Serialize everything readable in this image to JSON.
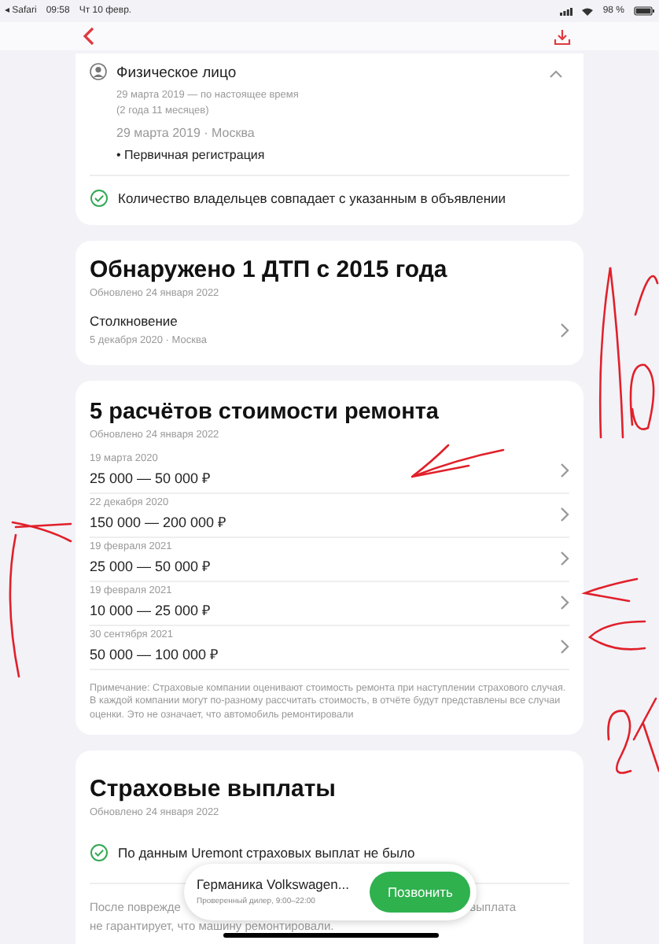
{
  "status_bar": {
    "app": "◂ Safari",
    "time": "09:58",
    "date": "Чт 10 февр.",
    "battery": "98 %"
  },
  "owner": {
    "title": "Физическое лицо",
    "period": "29 марта 2019 — по настоящее время",
    "duration": "(2 года 11 месяцев)",
    "event_date": "29 марта 2019 · Москва",
    "event": "• Первичная регистрация",
    "expanded": true,
    "check": "Количество владельцев совпадает с указанным в объявлении"
  },
  "accidents": {
    "title": "Обнаружено 1 ДТП с 2015 года",
    "updated": "Обновлено 24 января 2022",
    "items": [
      {
        "title": "Столкновение",
        "subtitle": "5 декабря 2020 · Москва"
      }
    ]
  },
  "repairs": {
    "title": "5 расчётов стоимости ремонта",
    "updated": "Обновлено 24 января 2022",
    "items": [
      {
        "date": "19 марта 2020",
        "price": "25 000 — 50 000 ₽"
      },
      {
        "date": "22 декабря 2020",
        "price": "150 000 — 200 000 ₽"
      },
      {
        "date": "19 февраля 2021",
        "price": "25 000 — 50 000 ₽"
      },
      {
        "date": "19 февраля 2021",
        "price": "10 000 — 25 000 ₽"
      },
      {
        "date": "30 сентября 2021",
        "price": "50 000 — 100 000 ₽"
      }
    ],
    "note": "Примечание: Страховые компании оценивают стоимость ремонта при наступлении страхового случая. В каждой компании могут по-разному рассчитать стоимость, в отчёте будут представлены все случаи оценки. Это не означает, что автомобиль ремонтировали"
  },
  "insurance": {
    "title": "Страховые выплаты",
    "updated": "Обновлено 24 января 2022",
    "check": "По данным Uremont страховых выплат не было",
    "note_left": "После поврежде",
    "note_right": "выплата",
    "note_line2": "не гарантирует, что машину ремонтировали."
  },
  "dealer_bar": {
    "name": "Германика Volkswagen...",
    "info": "Проверенный дилер, 9:00–22:00",
    "button": "Позвонить"
  }
}
